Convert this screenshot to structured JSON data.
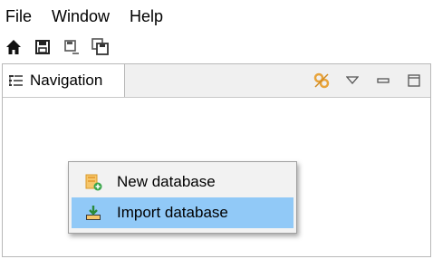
{
  "menubar": {
    "items": [
      {
        "label": "File"
      },
      {
        "label": "Window"
      },
      {
        "label": "Help"
      }
    ]
  },
  "toolbar": {
    "buttons": [
      {
        "icon": "home-icon"
      },
      {
        "icon": "save-icon"
      },
      {
        "icon": "save-as-icon"
      },
      {
        "icon": "save-all-icon"
      }
    ]
  },
  "view": {
    "tab_label": "Navigation",
    "tab_icon": "navigation-tree-icon",
    "tools": [
      "link-settings-icon",
      "view-menu-icon",
      "minimize-icon",
      "maximize-icon"
    ]
  },
  "context_menu": {
    "items": [
      {
        "label": "New database",
        "icon": "new-database-icon",
        "highlighted": false
      },
      {
        "label": "Import database",
        "icon": "import-database-icon",
        "highlighted": true
      }
    ]
  },
  "colors": {
    "highlight": "#91c9f7",
    "menu_background": "#f2f2f2",
    "icon_orange": "#e8a33a",
    "icon_green": "#3aa64a"
  }
}
